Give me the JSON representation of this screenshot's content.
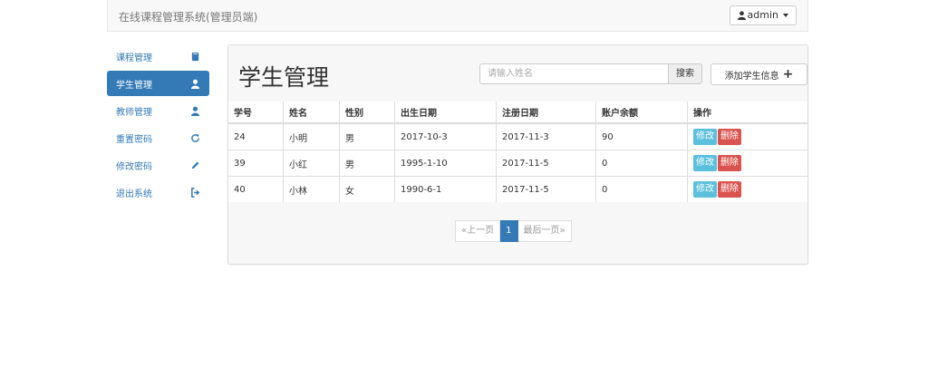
{
  "navbar": {
    "brand": "在线课程管理系统(管理员端)",
    "user": "admin"
  },
  "sidebar": {
    "items": [
      {
        "label": "课程管理",
        "icon": "book-icon"
      },
      {
        "label": "学生管理",
        "icon": "user-icon",
        "active": true
      },
      {
        "label": "教师管理",
        "icon": "user-icon"
      },
      {
        "label": "重置密码",
        "icon": "refresh-icon"
      },
      {
        "label": "修改密码",
        "icon": "pencil-icon"
      },
      {
        "label": "退出系统",
        "icon": "logout-icon"
      }
    ]
  },
  "main": {
    "title": "学生管理",
    "search": {
      "placeholder": "请输入姓名",
      "button": "搜索"
    },
    "add_button": "添加学生信息",
    "table": {
      "headers": [
        "学号",
        "姓名",
        "性别",
        "出生日期",
        "注册日期",
        "账户余额",
        "操作"
      ],
      "rows": [
        {
          "id": "24",
          "name": "小明",
          "gender": "男",
          "birth": "2017-10-3",
          "reg": "2017-11-3",
          "balance": "90"
        },
        {
          "id": "39",
          "name": "小红",
          "gender": "男",
          "birth": "1995-1-10",
          "reg": "2017-11-5",
          "balance": "0"
        },
        {
          "id": "40",
          "name": "小林",
          "gender": "女",
          "birth": "1990-6-1",
          "reg": "2017-11-5",
          "balance": "0"
        }
      ],
      "edit_label": "修改",
      "delete_label": "删除"
    },
    "pagination": {
      "prev": "«上一页",
      "current": "1",
      "last": "最后一页»"
    }
  },
  "colors": {
    "primary": "#337ab7",
    "info": "#5bc0de",
    "danger": "#d9534f"
  }
}
